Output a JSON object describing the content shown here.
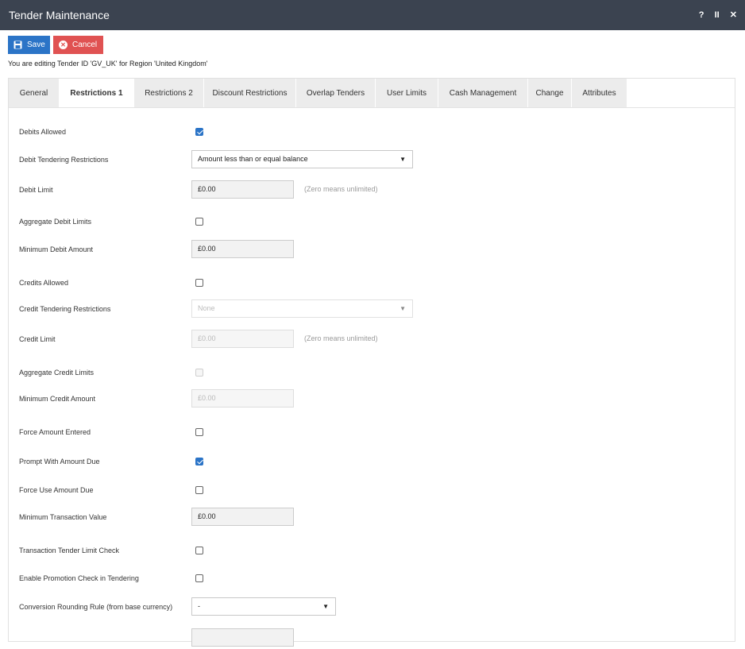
{
  "window": {
    "title": "Tender Maintenance",
    "help": "?",
    "pause": "II",
    "close": "✕"
  },
  "toolbar": {
    "save_label": "Save",
    "cancel_label": "Cancel"
  },
  "edit_info": "You are editing Tender ID 'GV_UK' for Region 'United Kingdom'",
  "tabs": [
    {
      "label": "General"
    },
    {
      "label": "Restrictions 1"
    },
    {
      "label": "Restrictions 2"
    },
    {
      "label": "Discount Restrictions"
    },
    {
      "label": "Overlap Tenders"
    },
    {
      "label": "User Limits"
    },
    {
      "label": "Cash Management"
    },
    {
      "label": "Change"
    },
    {
      "label": "Attributes"
    }
  ],
  "active_tab": "Restrictions 1",
  "form": {
    "debits_allowed": {
      "label": "Debits Allowed",
      "checked": true
    },
    "debit_tendering_restrictions": {
      "label": "Debit Tendering Restrictions",
      "value": "Amount less than or equal balance"
    },
    "debit_limit": {
      "label": "Debit Limit",
      "value": "£0.00",
      "hint": "(Zero means unlimited)"
    },
    "aggregate_debit_limits": {
      "label": "Aggregate Debit Limits",
      "checked": false
    },
    "minimum_debit_amount": {
      "label": "Minimum Debit Amount",
      "value": "£0.00"
    },
    "credits_allowed": {
      "label": "Credits Allowed",
      "checked": false
    },
    "credit_tendering_restrictions": {
      "label": "Credit Tendering Restrictions",
      "value": "None"
    },
    "credit_limit": {
      "label": "Credit Limit",
      "value": "£0.00",
      "hint": "(Zero means unlimited)"
    },
    "aggregate_credit_limits": {
      "label": "Aggregate Credit Limits",
      "checked": false
    },
    "minimum_credit_amount": {
      "label": "Minimum Credit Amount",
      "value": "£0.00"
    },
    "force_amount_entered": {
      "label": "Force Amount Entered",
      "checked": false
    },
    "prompt_with_amount_due": {
      "label": "Prompt With Amount Due",
      "checked": true
    },
    "force_use_amount_due": {
      "label": "Force Use Amount Due",
      "checked": false
    },
    "minimum_transaction_value": {
      "label": "Minimum Transaction Value",
      "value": "£0.00"
    },
    "transaction_tender_limit_check": {
      "label": "Transaction Tender Limit Check",
      "checked": false
    },
    "enable_promotion_check": {
      "label": "Enable Promotion Check in Tendering",
      "checked": false
    },
    "conversion_rounding_rule": {
      "label": "Conversion Rounding Rule (from base currency)",
      "value": "-"
    }
  },
  "colors": {
    "titlebar": "#3b4350",
    "save": "#2b74c7",
    "cancel": "#e05252",
    "checkbox_checked": "#2b74c7"
  }
}
